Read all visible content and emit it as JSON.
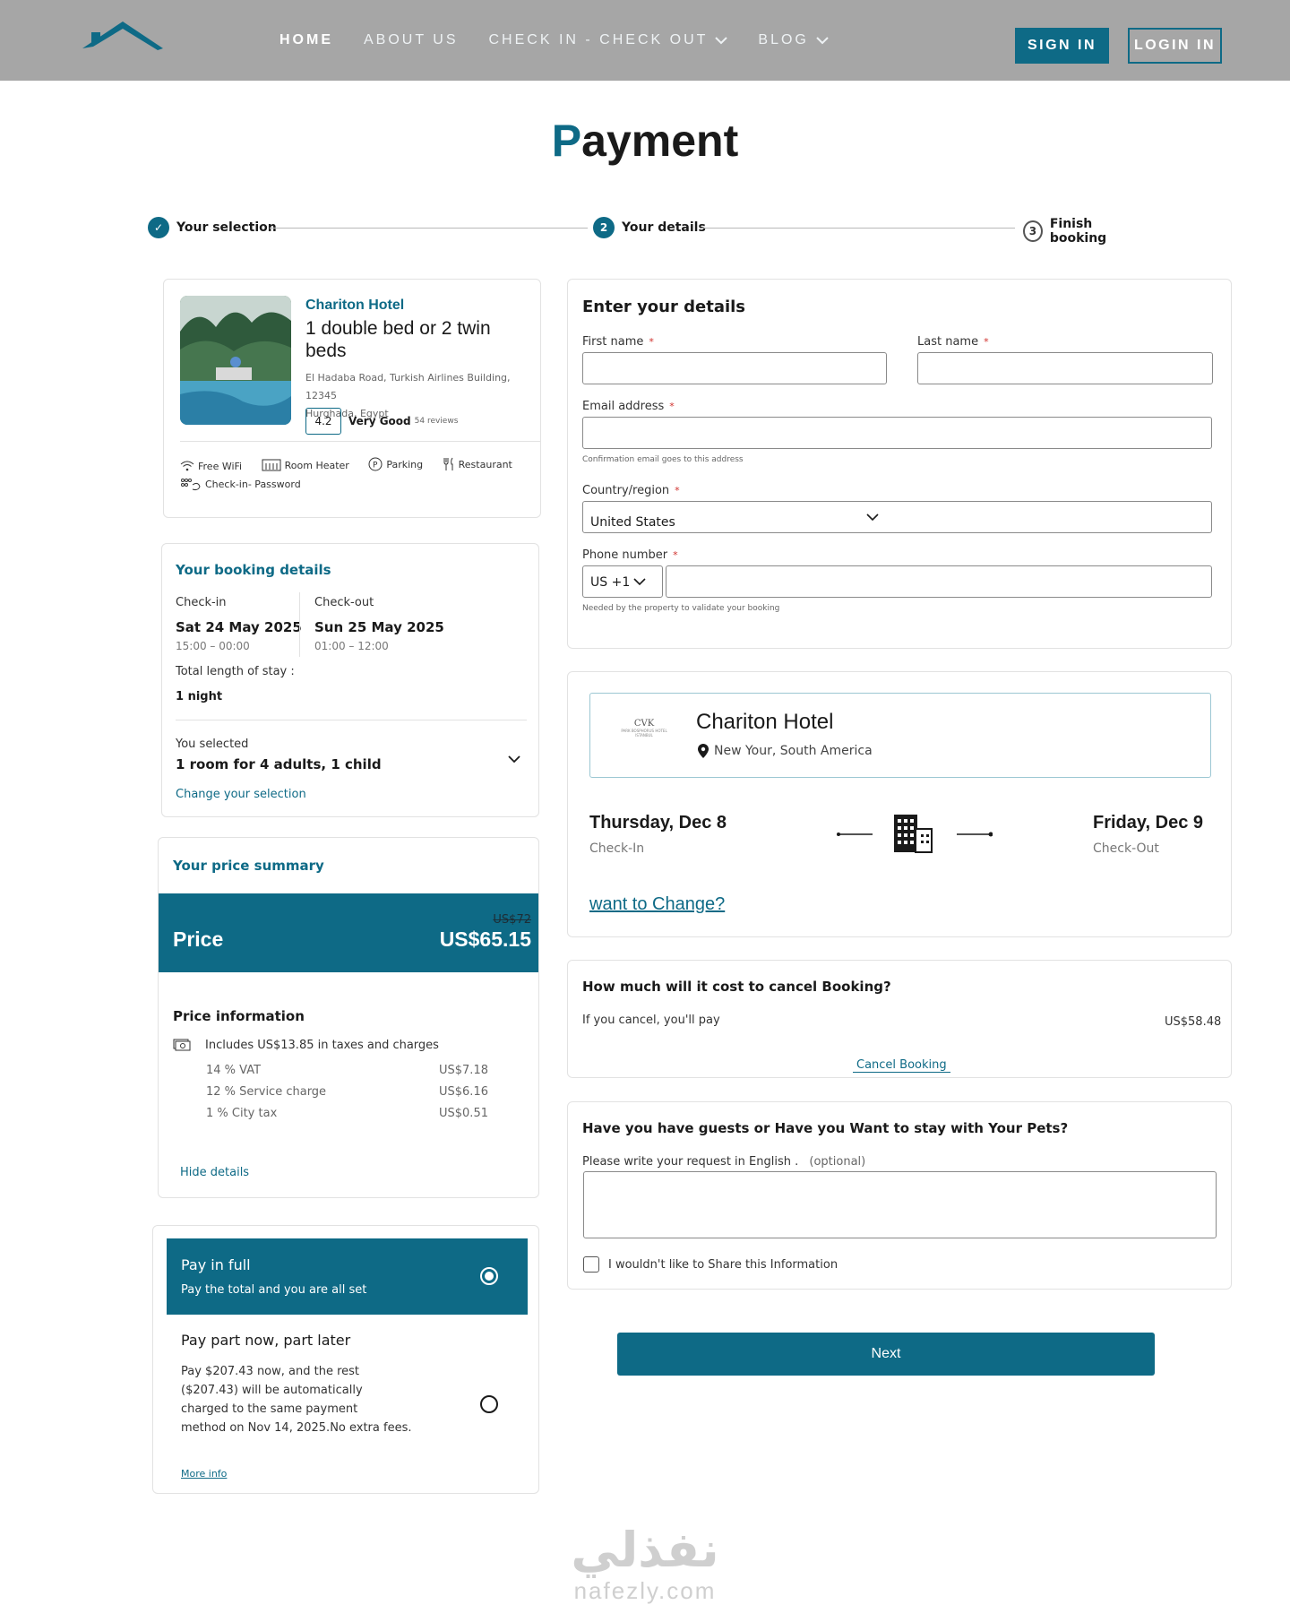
{
  "nav": {
    "items": [
      {
        "label": "HOME",
        "active": true,
        "dropdown": false
      },
      {
        "label": "ABOUT US",
        "active": false,
        "dropdown": false
      },
      {
        "label": "CHECK IN - CHECK OUT",
        "active": false,
        "dropdown": true
      },
      {
        "label": "BLOG",
        "active": false,
        "dropdown": true
      }
    ],
    "sign_in": "SIGN IN",
    "login": "LOGIN IN"
  },
  "page": {
    "title_first": "P",
    "title_rest": "ayment"
  },
  "stepper": {
    "steps": [
      {
        "label": "Your selection",
        "marker": "✓",
        "state": "done"
      },
      {
        "label": "Your details",
        "marker": "2",
        "state": "current"
      },
      {
        "label": "Finish booking",
        "marker": "3",
        "state": "todo"
      }
    ]
  },
  "hotel": {
    "name": "Chariton Hotel",
    "room": "1 double bed or 2 twin beds",
    "address_line1": "El Hadaba Road, Turkish Airlines Building, 12345",
    "address_line2": "Hurghada, Egypt",
    "score": "4.2",
    "rating_label": "Very Good",
    "reviews": "54 reviews",
    "amenities": [
      "Free WiFi",
      "Room Heater",
      "Parking",
      "Restaurant",
      "Check-in- Password"
    ]
  },
  "booking": {
    "title": "Your booking details",
    "checkin_label": "Check-in",
    "checkin_date": "Sat 24 May 2025",
    "checkin_time": "15:00 – 00:00",
    "checkout_label": "Check-out",
    "checkout_date": "Sun 25 May 2025",
    "checkout_time": "01:00 – 12:00",
    "length_label": "Total length of stay :",
    "length_value": "1 night",
    "selected_label": "You selected",
    "selected_value": "1 room for 4 adults, 1 child",
    "change_link": "Change your selection"
  },
  "price": {
    "title": "Your price summary",
    "label": "Price",
    "old": "US$72",
    "new": "US$65.15",
    "info_title": "Price information",
    "includes": "Includes US$13.85 in taxes and charges",
    "taxes": [
      {
        "name": "14 % VAT",
        "amount": "US$7.18"
      },
      {
        "name": "12 % Service charge",
        "amount": "US$6.16"
      },
      {
        "name": "1 % City tax",
        "amount": "US$0.51"
      }
    ],
    "hide": "Hide details"
  },
  "payment": {
    "full_title": "Pay in full",
    "full_sub": "Pay the total and you are all set",
    "part_title": "Pay part now, part later",
    "part_line1": "Pay $207.43 now, and the rest",
    "part_line2": "($207.43) will be automatically",
    "part_line3": "charged to the same payment",
    "part_line4": "method on Nov 14, 2025.No extra fees.",
    "more": "More info"
  },
  "form": {
    "title": "Enter your details",
    "first_name": "First name",
    "last_name": "Last name",
    "email": "Email address",
    "email_hint": "Confirmation email goes to this address",
    "country": "Country/region",
    "country_value": "United States",
    "phone": "Phone number",
    "phone_code": "US +1",
    "phone_hint": "Needed by the property to validate your booking",
    "required_mark": "*"
  },
  "stay": {
    "logo_text": "CVK",
    "logo_sub": "PARK BOSPHORUS HOTEL",
    "logo_sub2": "ISTANBUL",
    "hotel_name": "Chariton Hotel",
    "location": "New Your, South America",
    "checkin_date": "Thursday, Dec 8",
    "checkin_label": "Check-In",
    "checkout_date": "Friday, Dec 9",
    "checkout_label": "Check-Out",
    "change": "want to Change?"
  },
  "cancel": {
    "title": "How much will it cost to cancel Booking?",
    "text": "If you cancel, you'll pay",
    "amount": "US$58.48",
    "link": "Cancel Booking"
  },
  "guests": {
    "title": "Have you have guests or Have you Want to stay with Your Pets?",
    "label": "Please write your request in English .",
    "optional": "(optional)",
    "checkbox": "I wouldn't like to Share this Information"
  },
  "next": "Next",
  "watermark": {
    "arabic": "نفذلي",
    "latin": "nafezly.com"
  },
  "colors": {
    "brand": "#0e6a86",
    "header_bg": "#a6a6a6",
    "required": "#d0312d"
  }
}
